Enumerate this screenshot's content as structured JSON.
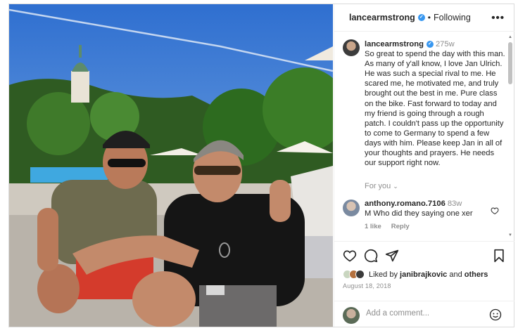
{
  "post": {
    "author": "lancearmstrong",
    "follow_status": "Following",
    "separator": "•",
    "more_label": "•••"
  },
  "caption": {
    "username": "lancearmstrong",
    "time": "275w",
    "text": "So great to spend the day with this man. As many of y'all know, I love Jan Ulrich. He was such a special rival to me. He scared me, he motivated me, and truly brought out the best in me. Pure class on the bike. Fast forward to today and my friend is going through a rough patch. I couldn't pass up the opportunity to come to Germany to spend a few days with him. Please keep Jan in all of your thoughts and prayers. He needs our support right now."
  },
  "for_you": {
    "label": "For you",
    "chevron": "⌄"
  },
  "comment": {
    "username": "anthony.romano.7106",
    "time": "83w",
    "text": "M Who did they saying one xer",
    "likes": "1 like",
    "reply": "Reply"
  },
  "likes": {
    "prefix": "Liked by ",
    "user": "janibrajkovic",
    "middle": " and ",
    "others": "others"
  },
  "date": "August 18, 2018",
  "add_comment": {
    "placeholder": "Add a comment..."
  },
  "colors": {
    "verified": "#3897f0",
    "muted": "#8e8e8e",
    "text": "#262626"
  },
  "icons": [
    "heart-icon",
    "comment-icon",
    "share-icon",
    "bookmark-icon",
    "emoji-icon",
    "verified-icon",
    "more-icon"
  ]
}
